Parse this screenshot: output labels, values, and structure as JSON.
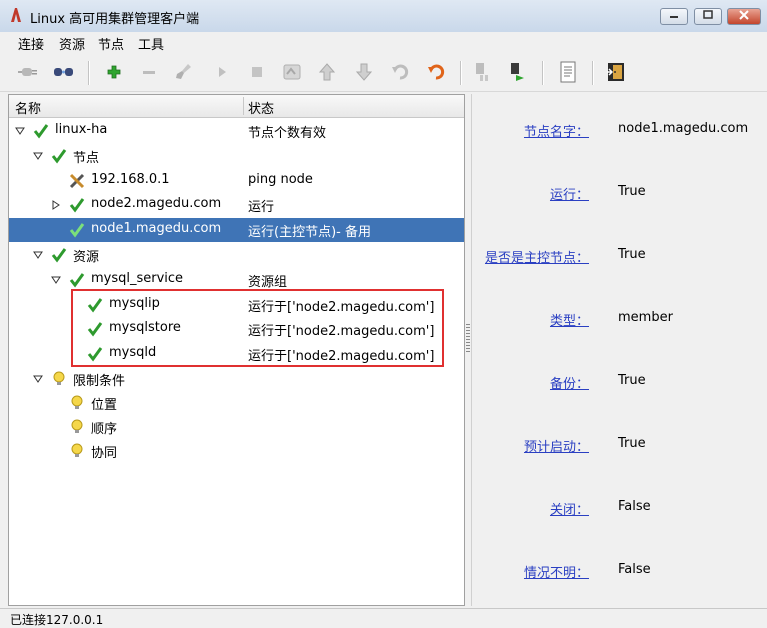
{
  "window": {
    "title": "Linux 高可用集群管理客户端"
  },
  "menu": [
    "连接",
    "资源",
    "节点",
    "工具"
  ],
  "tree": {
    "headers": {
      "name": "名称",
      "state": "状态"
    },
    "rows": [
      {
        "name": "linux-ha",
        "state": "节点个数有效",
        "icon": "check-icon"
      },
      {
        "name": "节点",
        "state": "",
        "icon": "check-icon"
      },
      {
        "name": "192.168.0.1",
        "state": "ping node",
        "icon": "tools-icon"
      },
      {
        "name": "node2.magedu.com",
        "state": "运行",
        "icon": "check-icon"
      },
      {
        "name": "node1.magedu.com",
        "state": "运行(主控节点)- 备用",
        "icon": "check-icon",
        "selected": true
      },
      {
        "name": "资源",
        "state": "",
        "icon": "check-icon"
      },
      {
        "name": "mysql_service",
        "state": "资源组",
        "icon": "check-icon"
      },
      {
        "name": "mysqlip",
        "state": "运行于['node2.magedu.com']",
        "icon": "check-icon"
      },
      {
        "name": "mysqlstore",
        "state": "运行于['node2.magedu.com']",
        "icon": "check-icon"
      },
      {
        "name": "mysqld",
        "state": "运行于['node2.magedu.com']",
        "icon": "check-icon"
      },
      {
        "name": "限制条件",
        "state": "",
        "icon": "bulb-icon"
      },
      {
        "name": "位置",
        "state": "",
        "icon": "bulb-icon"
      },
      {
        "name": "顺序",
        "state": "",
        "icon": "bulb-icon"
      },
      {
        "name": "协同",
        "state": "",
        "icon": "bulb-icon"
      }
    ]
  },
  "properties": [
    {
      "label": "节点名字：",
      "value": "node1.magedu.com"
    },
    {
      "label": "运行：",
      "value": "True"
    },
    {
      "label": "是否是主控节点：",
      "value": "True"
    },
    {
      "label": "类型：",
      "value": "member"
    },
    {
      "label": "备份：",
      "value": "True"
    },
    {
      "label": "预计启动：",
      "value": "True"
    },
    {
      "label": "关闭：",
      "value": "False"
    },
    {
      "label": "情况不明：",
      "value": "False"
    }
  ],
  "status": {
    "text": "已连接127.0.0.1"
  },
  "colors": {
    "selection": "#3f74b6",
    "check": "#2e9a2e",
    "link": "#2a3fc2",
    "highlight_box": "#e03030"
  }
}
